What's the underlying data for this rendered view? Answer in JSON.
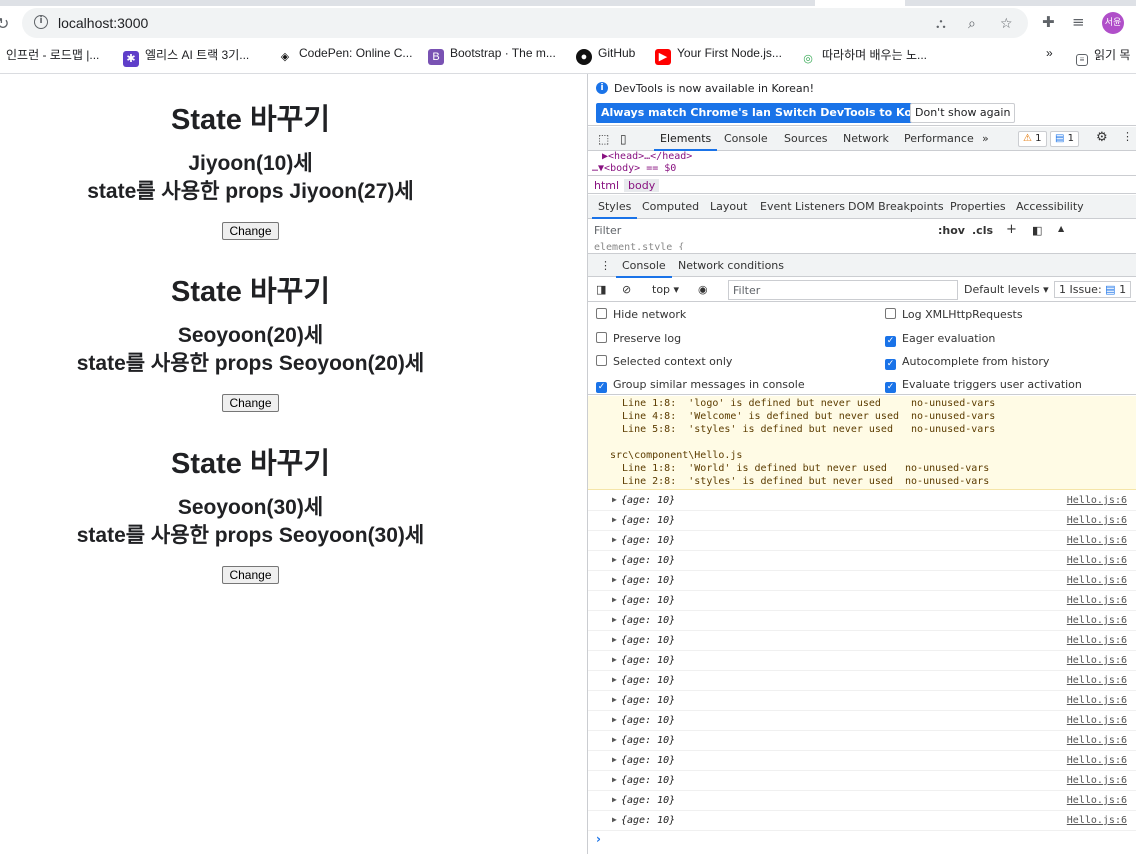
{
  "browser": {
    "url": "localhost:3000",
    "profile_label": "서윤",
    "bookmarks": [
      "인프런 - 로드맵 |...",
      "엘리스 AI 트랙 3기...",
      "CodePen: Online C...",
      "Bootstrap · The m...",
      "GitHub",
      "Your First Node.js...",
      "따라하며 배우는 노...",
      "읽기 목"
    ],
    "more_bookmarks": "»"
  },
  "page": {
    "blocks": [
      {
        "title": "State 바꾸기",
        "line1": "Jiyoon(10)세",
        "line2": "state를 사용한 props Jiyoon(27)세",
        "button": "Change"
      },
      {
        "title": "State 바꾸기",
        "line1": "Seoyoon(20)세",
        "line2": "state를 사용한 props Seoyoon(20)세",
        "button": "Change"
      },
      {
        "title": "State 바꾸기",
        "line1": "Seoyoon(30)세",
        "line2": "state를 사용한 props Seoyoon(30)세",
        "button": "Change"
      }
    ]
  },
  "devtools": {
    "notice": "DevTools is now available in Korean!",
    "btn_match": "Always match Chrome's language",
    "btn_switch": "Switch DevTools to Korean",
    "btn_dont": "Don't show again",
    "tabs": [
      "Elements",
      "Console",
      "Sources",
      "Network",
      "Performance"
    ],
    "tabs_more": "»",
    "warn_count": "1",
    "info_count": "1",
    "dom_line1": "▶<head>…</head>",
    "dom_line2": "▼<body> == $0",
    "crumbs": [
      "html",
      "body"
    ],
    "sub_tabs": [
      "Styles",
      "Computed",
      "Layout",
      "Event Listeners",
      "DOM Breakpoints",
      "Properties",
      "Accessibility"
    ],
    "filter_placeholder": "Filter",
    "hov": ":hov",
    "cls": ".cls",
    "element_style": "element.style {",
    "drawer_tabs": [
      "Console",
      "Network conditions"
    ],
    "context": "top",
    "console_filter": "Filter",
    "levels": "Default levels",
    "issues": "1 Issue:",
    "issues_count": "1",
    "settings": [
      {
        "label": "Hide network",
        "checked": false
      },
      {
        "label": "Log XMLHttpRequests",
        "checked": false
      },
      {
        "label": "Preserve log",
        "checked": false
      },
      {
        "label": "Eager evaluation",
        "checked": true
      },
      {
        "label": "Selected context only",
        "checked": false
      },
      {
        "label": "Autocomplete from history",
        "checked": true
      },
      {
        "label": "Group similar messages in console",
        "checked": true
      },
      {
        "label": "Evaluate triggers user activation",
        "checked": true
      }
    ],
    "warning_text": "  Line 1:8:  'logo' is defined but never used     no-unused-vars\n  Line 4:8:  'Welcome' is defined but never used  no-unused-vars\n  Line 5:8:  'styles' is defined but never used   no-unused-vars\n\nsrc\\component\\Hello.js\n  Line 1:8:  'World' is defined but never used   no-unused-vars\n  Line 2:8:  'styles' is defined but never used  no-unused-vars",
    "log_entries": [
      {
        "text": "{age: 10}",
        "source": "Hello.js:6"
      },
      {
        "text": "{age: 10}",
        "source": "Hello.js:6"
      },
      {
        "text": "{age: 10}",
        "source": "Hello.js:6"
      },
      {
        "text": "{age: 10}",
        "source": "Hello.js:6"
      },
      {
        "text": "{age: 10}",
        "source": "Hello.js:6"
      },
      {
        "text": "{age: 10}",
        "source": "Hello.js:6"
      },
      {
        "text": "{age: 10}",
        "source": "Hello.js:6"
      },
      {
        "text": "{age: 10}",
        "source": "Hello.js:6"
      },
      {
        "text": "{age: 10}",
        "source": "Hello.js:6"
      },
      {
        "text": "{age: 10}",
        "source": "Hello.js:6"
      },
      {
        "text": "{age: 10}",
        "source": "Hello.js:6"
      },
      {
        "text": "{age: 10}",
        "source": "Hello.js:6"
      },
      {
        "text": "{age: 10}",
        "source": "Hello.js:6"
      },
      {
        "text": "{age: 10}",
        "source": "Hello.js:6"
      },
      {
        "text": "{age: 10}",
        "source": "Hello.js:6"
      },
      {
        "text": "{age: 10}",
        "source": "Hello.js:6"
      },
      {
        "text": "{age: 10}",
        "source": "Hello.js:6"
      }
    ],
    "prompt": "›"
  }
}
